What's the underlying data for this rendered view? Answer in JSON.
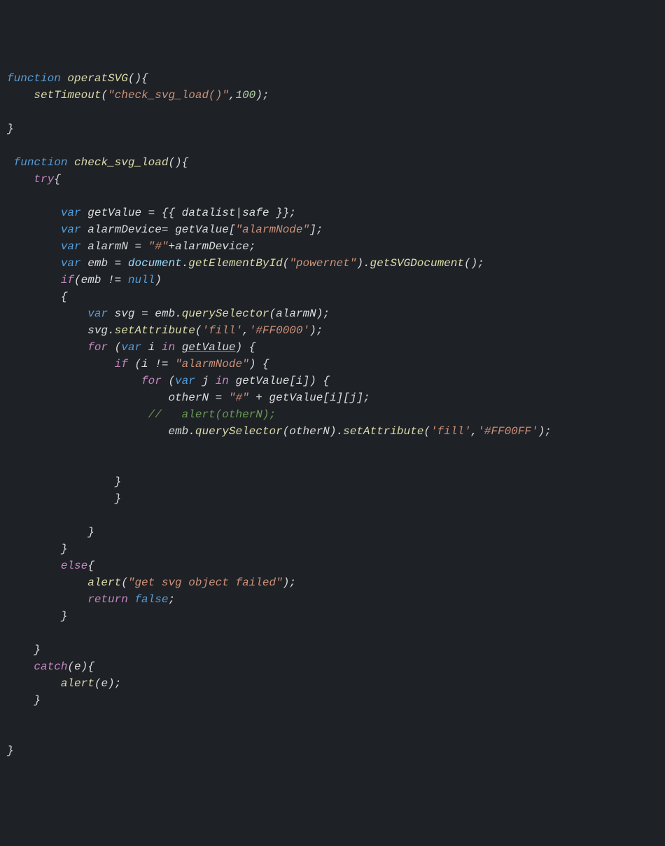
{
  "code": {
    "lines": [
      [
        {
          "cls": "kw",
          "t": "function"
        },
        {
          "cls": "punct",
          "t": " "
        },
        {
          "cls": "fname",
          "t": "operatSVG"
        },
        {
          "cls": "punct",
          "t": "(){"
        }
      ],
      [
        {
          "cls": "punct",
          "t": "    "
        },
        {
          "cls": "fname",
          "t": "setTimeout"
        },
        {
          "cls": "punct",
          "t": "("
        },
        {
          "cls": "str",
          "t": "\"check_svg_load()\""
        },
        {
          "cls": "punct",
          "t": ","
        },
        {
          "cls": "num",
          "t": "100"
        },
        {
          "cls": "punct",
          "t": ");"
        }
      ],
      [
        {
          "cls": "punct",
          "t": ""
        }
      ],
      [
        {
          "cls": "punct",
          "t": "}"
        }
      ],
      [
        {
          "cls": "punct",
          "t": ""
        }
      ],
      [
        {
          "cls": "punct",
          "t": " "
        },
        {
          "cls": "kw",
          "t": "function"
        },
        {
          "cls": "punct",
          "t": " "
        },
        {
          "cls": "fname",
          "t": "check_svg_load"
        },
        {
          "cls": "punct",
          "t": "(){"
        }
      ],
      [
        {
          "cls": "punct",
          "t": "    "
        },
        {
          "cls": "kw2",
          "t": "try"
        },
        {
          "cls": "punct",
          "t": "{"
        }
      ],
      [
        {
          "cls": "punct",
          "t": ""
        }
      ],
      [
        {
          "cls": "punct",
          "t": "        "
        },
        {
          "cls": "kw",
          "t": "var"
        },
        {
          "cls": "punct",
          "t": " "
        },
        {
          "cls": "ident",
          "t": "getValue"
        },
        {
          "cls": "punct",
          "t": " "
        },
        {
          "cls": "op",
          "t": "="
        },
        {
          "cls": "punct",
          "t": " {{ datalist"
        },
        {
          "cls": "op",
          "t": "|"
        },
        {
          "cls": "ident",
          "t": "safe"
        },
        {
          "cls": "punct",
          "t": " }};"
        }
      ],
      [
        {
          "cls": "punct",
          "t": "        "
        },
        {
          "cls": "kw",
          "t": "var"
        },
        {
          "cls": "punct",
          "t": " "
        },
        {
          "cls": "ident",
          "t": "alarmDevice"
        },
        {
          "cls": "op",
          "t": "= "
        },
        {
          "cls": "ident",
          "t": "getValue"
        },
        {
          "cls": "punct",
          "t": "["
        },
        {
          "cls": "str",
          "t": "\"alarmNode\""
        },
        {
          "cls": "punct",
          "t": "];"
        }
      ],
      [
        {
          "cls": "punct",
          "t": "        "
        },
        {
          "cls": "kw",
          "t": "var"
        },
        {
          "cls": "punct",
          "t": " "
        },
        {
          "cls": "ident",
          "t": "alarmN"
        },
        {
          "cls": "punct",
          "t": " "
        },
        {
          "cls": "op",
          "t": "="
        },
        {
          "cls": "punct",
          "t": " "
        },
        {
          "cls": "str",
          "t": "\"#\""
        },
        {
          "cls": "op",
          "t": "+"
        },
        {
          "cls": "ident",
          "t": "alarmDevice"
        },
        {
          "cls": "punct",
          "t": ";"
        }
      ],
      [
        {
          "cls": "punct",
          "t": "        "
        },
        {
          "cls": "kw",
          "t": "var"
        },
        {
          "cls": "punct",
          "t": " "
        },
        {
          "cls": "ident",
          "t": "emb"
        },
        {
          "cls": "punct",
          "t": " "
        },
        {
          "cls": "op",
          "t": "="
        },
        {
          "cls": "punct",
          "t": " "
        },
        {
          "cls": "builtin",
          "t": "document"
        },
        {
          "cls": "punct",
          "t": "."
        },
        {
          "cls": "fname",
          "t": "getElementById"
        },
        {
          "cls": "punct",
          "t": "("
        },
        {
          "cls": "str",
          "t": "\"powernet\""
        },
        {
          "cls": "punct",
          "t": ")."
        },
        {
          "cls": "fname",
          "t": "getSVGDocument"
        },
        {
          "cls": "punct",
          "t": "();"
        }
      ],
      [
        {
          "cls": "punct",
          "t": "        "
        },
        {
          "cls": "kw2",
          "t": "if"
        },
        {
          "cls": "punct",
          "t": "("
        },
        {
          "cls": "ident",
          "t": "emb"
        },
        {
          "cls": "punct",
          "t": " "
        },
        {
          "cls": "op",
          "t": "!="
        },
        {
          "cls": "punct",
          "t": " "
        },
        {
          "cls": "const",
          "t": "null"
        },
        {
          "cls": "punct",
          "t": ")"
        }
      ],
      [
        {
          "cls": "punct",
          "t": "        {"
        }
      ],
      [
        {
          "cls": "punct",
          "t": "            "
        },
        {
          "cls": "kw",
          "t": "var"
        },
        {
          "cls": "punct",
          "t": " "
        },
        {
          "cls": "ident",
          "t": "svg"
        },
        {
          "cls": "punct",
          "t": " "
        },
        {
          "cls": "op",
          "t": "="
        },
        {
          "cls": "punct",
          "t": " "
        },
        {
          "cls": "ident",
          "t": "emb"
        },
        {
          "cls": "punct",
          "t": "."
        },
        {
          "cls": "fname",
          "t": "querySelector"
        },
        {
          "cls": "punct",
          "t": "("
        },
        {
          "cls": "ident",
          "t": "alarmN"
        },
        {
          "cls": "punct",
          "t": ");"
        }
      ],
      [
        {
          "cls": "punct",
          "t": "            "
        },
        {
          "cls": "ident",
          "t": "svg"
        },
        {
          "cls": "punct",
          "t": "."
        },
        {
          "cls": "fname",
          "t": "setAttribute"
        },
        {
          "cls": "punct",
          "t": "("
        },
        {
          "cls": "str",
          "t": "'fill'"
        },
        {
          "cls": "punct",
          "t": ","
        },
        {
          "cls": "str",
          "t": "'#FF0000'"
        },
        {
          "cls": "punct",
          "t": ");"
        }
      ],
      [
        {
          "cls": "punct",
          "t": "            "
        },
        {
          "cls": "kw2",
          "t": "for"
        },
        {
          "cls": "punct",
          "t": " ("
        },
        {
          "cls": "kw",
          "t": "var"
        },
        {
          "cls": "punct",
          "t": " "
        },
        {
          "cls": "ident",
          "t": "i"
        },
        {
          "cls": "punct",
          "t": " "
        },
        {
          "cls": "kw2",
          "t": "in"
        },
        {
          "cls": "punct",
          "t": " "
        },
        {
          "cls": "ident underline",
          "t": "getValue"
        },
        {
          "cls": "punct",
          "t": ") {"
        }
      ],
      [
        {
          "cls": "punct",
          "t": "                "
        },
        {
          "cls": "kw2",
          "t": "if"
        },
        {
          "cls": "punct",
          "t": " ("
        },
        {
          "cls": "ident",
          "t": "i"
        },
        {
          "cls": "punct",
          "t": " "
        },
        {
          "cls": "op",
          "t": "!="
        },
        {
          "cls": "punct",
          "t": " "
        },
        {
          "cls": "str",
          "t": "\"alarmNode\""
        },
        {
          "cls": "punct",
          "t": ") {"
        }
      ],
      [
        {
          "cls": "punct",
          "t": "                    "
        },
        {
          "cls": "kw2",
          "t": "for"
        },
        {
          "cls": "punct",
          "t": " ("
        },
        {
          "cls": "kw",
          "t": "var"
        },
        {
          "cls": "punct",
          "t": " "
        },
        {
          "cls": "ident",
          "t": "j"
        },
        {
          "cls": "punct",
          "t": " "
        },
        {
          "cls": "kw2",
          "t": "in"
        },
        {
          "cls": "punct",
          "t": " "
        },
        {
          "cls": "ident",
          "t": "getValue"
        },
        {
          "cls": "punct",
          "t": "["
        },
        {
          "cls": "ident",
          "t": "i"
        },
        {
          "cls": "punct",
          "t": "]) {"
        }
      ],
      [
        {
          "cls": "punct",
          "t": "                        "
        },
        {
          "cls": "ident",
          "t": "otherN"
        },
        {
          "cls": "punct",
          "t": " "
        },
        {
          "cls": "op",
          "t": "="
        },
        {
          "cls": "punct",
          "t": " "
        },
        {
          "cls": "str",
          "t": "\"#\""
        },
        {
          "cls": "punct",
          "t": " "
        },
        {
          "cls": "op",
          "t": "+"
        },
        {
          "cls": "punct",
          "t": " "
        },
        {
          "cls": "ident",
          "t": "getValue"
        },
        {
          "cls": "punct",
          "t": "["
        },
        {
          "cls": "ident",
          "t": "i"
        },
        {
          "cls": "punct",
          "t": "]["
        },
        {
          "cls": "ident",
          "t": "j"
        },
        {
          "cls": "punct",
          "t": "];"
        }
      ],
      [
        {
          "cls": "punct",
          "t": "                     "
        },
        {
          "cls": "comment",
          "t": "//   alert(otherN);"
        }
      ],
      [
        {
          "cls": "punct",
          "t": "                        "
        },
        {
          "cls": "ident",
          "t": "emb"
        },
        {
          "cls": "punct",
          "t": "."
        },
        {
          "cls": "fname",
          "t": "querySelector"
        },
        {
          "cls": "punct",
          "t": "("
        },
        {
          "cls": "ident",
          "t": "otherN"
        },
        {
          "cls": "punct",
          "t": ")."
        },
        {
          "cls": "fname",
          "t": "setAttribute"
        },
        {
          "cls": "punct",
          "t": "("
        },
        {
          "cls": "str",
          "t": "'fill'"
        },
        {
          "cls": "punct",
          "t": ","
        },
        {
          "cls": "str",
          "t": "'#FF00FF'"
        },
        {
          "cls": "punct",
          "t": ");"
        }
      ],
      [
        {
          "cls": "punct",
          "t": ""
        }
      ],
      [
        {
          "cls": "punct",
          "t": ""
        }
      ],
      [
        {
          "cls": "punct",
          "t": "                }"
        }
      ],
      [
        {
          "cls": "punct",
          "t": "                }"
        }
      ],
      [
        {
          "cls": "punct",
          "t": ""
        }
      ],
      [
        {
          "cls": "punct",
          "t": "            }"
        }
      ],
      [
        {
          "cls": "punct",
          "t": "        }"
        }
      ],
      [
        {
          "cls": "punct",
          "t": "        "
        },
        {
          "cls": "kw2",
          "t": "else"
        },
        {
          "cls": "punct",
          "t": "{"
        }
      ],
      [
        {
          "cls": "punct",
          "t": "            "
        },
        {
          "cls": "fname",
          "t": "alert"
        },
        {
          "cls": "punct",
          "t": "("
        },
        {
          "cls": "str",
          "t": "\"get svg object failed\""
        },
        {
          "cls": "punct",
          "t": ");"
        }
      ],
      [
        {
          "cls": "punct",
          "t": "            "
        },
        {
          "cls": "kw2",
          "t": "return"
        },
        {
          "cls": "punct",
          "t": " "
        },
        {
          "cls": "const",
          "t": "false"
        },
        {
          "cls": "punct",
          "t": ";"
        }
      ],
      [
        {
          "cls": "punct",
          "t": "        }"
        }
      ],
      [
        {
          "cls": "punct",
          "t": ""
        }
      ],
      [
        {
          "cls": "punct",
          "t": "    }"
        }
      ],
      [
        {
          "cls": "punct",
          "t": "    "
        },
        {
          "cls": "kw2",
          "t": "catch"
        },
        {
          "cls": "punct",
          "t": "("
        },
        {
          "cls": "ident",
          "t": "e"
        },
        {
          "cls": "punct",
          "t": "){"
        }
      ],
      [
        {
          "cls": "punct",
          "t": "        "
        },
        {
          "cls": "fname",
          "t": "alert"
        },
        {
          "cls": "punct",
          "t": "("
        },
        {
          "cls": "ident",
          "t": "e"
        },
        {
          "cls": "punct",
          "t": ");"
        }
      ],
      [
        {
          "cls": "punct",
          "t": "    }"
        }
      ],
      [
        {
          "cls": "punct",
          "t": ""
        }
      ],
      [
        {
          "cls": "punct",
          "t": ""
        }
      ],
      [
        {
          "cls": "punct",
          "t": "}"
        }
      ]
    ]
  }
}
